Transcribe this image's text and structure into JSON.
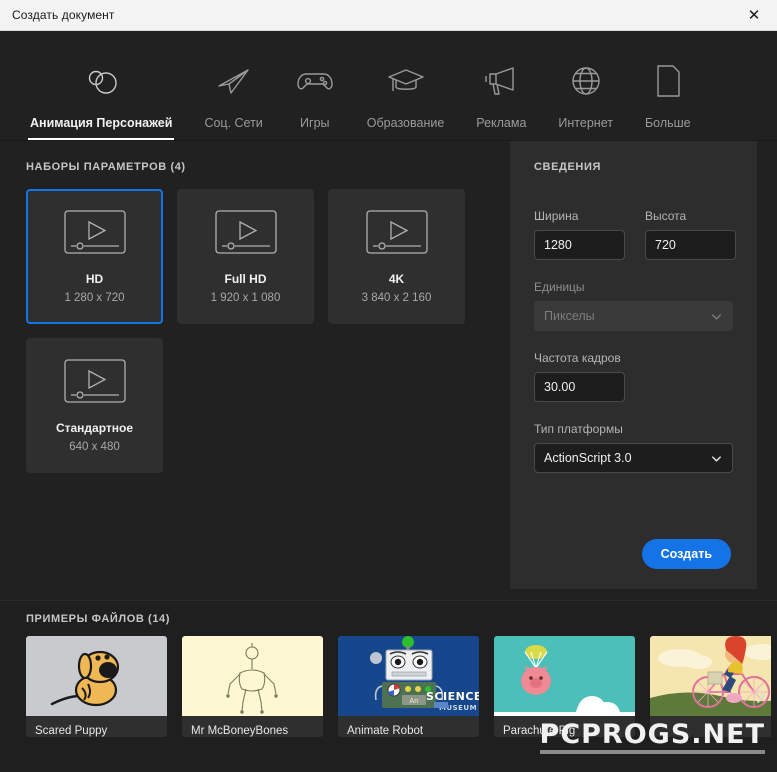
{
  "window": {
    "title": "Создать документ",
    "close_icon": "close-icon"
  },
  "tabs": [
    {
      "label": "Анимация Персонажей",
      "icon": "character-animation-icon",
      "active": true
    },
    {
      "label": "Соц. Сети",
      "icon": "paper-plane-icon",
      "active": false
    },
    {
      "label": "Игры",
      "icon": "gamepad-icon",
      "active": false
    },
    {
      "label": "Образование",
      "icon": "graduation-cap-icon",
      "active": false
    },
    {
      "label": "Реклама",
      "icon": "megaphone-icon",
      "active": false
    },
    {
      "label": "Интернет",
      "icon": "globe-icon",
      "active": false
    },
    {
      "label": "Больше",
      "icon": "document-icon",
      "active": false
    }
  ],
  "presets": {
    "section_title": "НАБОРЫ ПАРАМЕТРОВ (4)",
    "items": [
      {
        "name": "HD",
        "dims": "1 280 x 720",
        "selected": true
      },
      {
        "name": "Full HD",
        "dims": "1 920 x 1 080",
        "selected": false
      },
      {
        "name": "4K",
        "dims": "3 840 x 2 160",
        "selected": false
      },
      {
        "name": "Стандартное",
        "dims": "640 x 480",
        "selected": false
      }
    ]
  },
  "details": {
    "section_title": "СВЕДЕНИЯ",
    "width_label": "Ширина",
    "width_value": "1280",
    "height_label": "Высота",
    "height_value": "720",
    "units_label": "Единицы",
    "units_value": "Пикселы",
    "framerate_label": "Частота кадров",
    "framerate_value": "30.00",
    "platform_label": "Тип платформы",
    "platform_value": "ActionScript 3.0",
    "create_label": "Создать",
    "accent_color": "#1473e6"
  },
  "samples": {
    "section_title": "ПРИМЕРЫ ФАЙЛОВ (14)",
    "items": [
      {
        "name": "Scared Puppy",
        "thumb": "puppy"
      },
      {
        "name": "Mr McBoneyBones",
        "thumb": "skeleton"
      },
      {
        "name": "Animate Robot",
        "thumb": "robot"
      },
      {
        "name": "Parachute Pig",
        "thumb": "pig"
      },
      {
        "name": "",
        "thumb": "bicycle"
      }
    ],
    "next_icon": "chevron-right-icon"
  },
  "watermark": {
    "text": "PCPROGS.NET"
  }
}
